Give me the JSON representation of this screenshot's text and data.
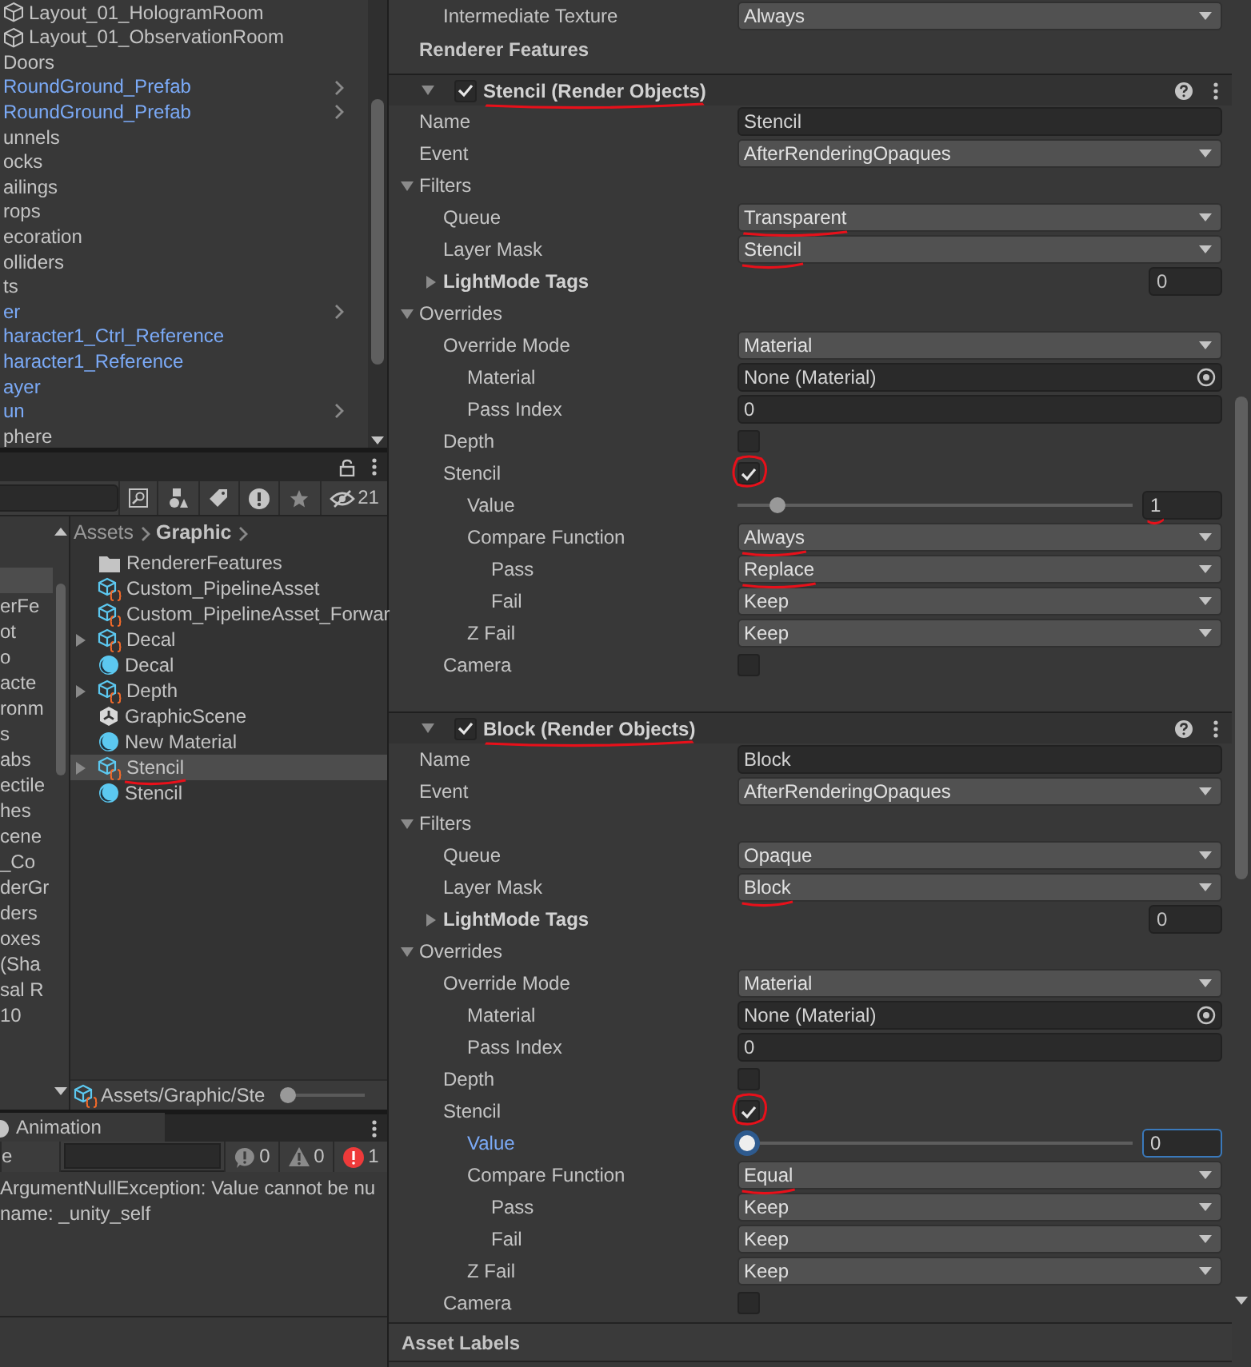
{
  "hierarchy": {
    "items": [
      {
        "label": "Layout_01_HologramRoom",
        "prefab": false,
        "has_children": false,
        "show_icon": true
      },
      {
        "label": "Layout_01_ObservationRoom",
        "prefab": false,
        "has_children": false,
        "show_icon": true
      },
      {
        "label": "Doors",
        "prefab": false,
        "has_children": false
      },
      {
        "label": "RoundGround_Prefab",
        "prefab": true,
        "has_children": true
      },
      {
        "label": "RoundGround_Prefab",
        "prefab": true,
        "has_children": true
      },
      {
        "label": "unnels",
        "prefab": false,
        "has_children": false
      },
      {
        "label": "ocks",
        "prefab": false,
        "has_children": false
      },
      {
        "label": "ailings",
        "prefab": false,
        "has_children": false
      },
      {
        "label": "rops",
        "prefab": false,
        "has_children": false
      },
      {
        "label": "ecoration",
        "prefab": false,
        "has_children": false
      },
      {
        "label": "olliders",
        "prefab": false,
        "has_children": false
      },
      {
        "label": "ts",
        "prefab": false,
        "has_children": false
      },
      {
        "label": "er",
        "prefab": true,
        "has_children": true
      },
      {
        "label": "haracter1_Ctrl_Reference",
        "prefab": true,
        "has_children": false
      },
      {
        "label": "haracter1_Reference",
        "prefab": true,
        "has_children": false
      },
      {
        "label": "ayer",
        "prefab": true,
        "has_children": false
      },
      {
        "label": "un",
        "prefab": true,
        "has_children": true
      },
      {
        "label": "phere",
        "prefab": false,
        "has_children": false
      }
    ]
  },
  "project": {
    "hidden_count": "21",
    "folder_tree": [
      {
        "selected": true
      },
      {
        "label": "erFe",
        "selected": false
      },
      {
        "label": "ot",
        "selected": false
      },
      {
        "label": "o",
        "selected": false
      },
      {
        "label": "acte",
        "selected": false
      },
      {
        "label": "ronm",
        "selected": false
      },
      {
        "label": "s",
        "selected": false
      },
      {
        "label": "abs",
        "selected": false
      },
      {
        "label": "ectile",
        "selected": false
      },
      {
        "label": "hes",
        "selected": false
      },
      {
        "label": "cene",
        "selected": false
      },
      {
        "label": "_Co",
        "selected": false
      },
      {
        "label": "derGr",
        "selected": false
      },
      {
        "label": "ders",
        "selected": false
      },
      {
        "label": "oxes",
        "selected": false
      },
      {
        "label": "(Sha",
        "selected": false
      },
      {
        "label": "sal R",
        "selected": false
      },
      {
        "label": "10",
        "selected": false
      }
    ],
    "breadcrumb": [
      {
        "label": "Assets",
        "bold": false
      },
      {
        "label": "Graphic",
        "bold": true
      }
    ],
    "items": [
      {
        "kind": "folder",
        "label": "RendererFeatures",
        "expandable": false,
        "selected": false
      },
      {
        "kind": "asset",
        "label": "Custom_PipelineAsset",
        "expandable": false,
        "selected": false
      },
      {
        "kind": "asset",
        "label": "Custom_PipelineAsset_Forwar",
        "expandable": false,
        "selected": false
      },
      {
        "kind": "asset",
        "label": "Decal",
        "expandable": true,
        "selected": false
      },
      {
        "kind": "material",
        "label": "Decal",
        "expandable": false,
        "selected": false
      },
      {
        "kind": "asset",
        "label": "Depth",
        "expandable": true,
        "selected": false
      },
      {
        "kind": "scene",
        "label": "GraphicScene",
        "expandable": false,
        "selected": false
      },
      {
        "kind": "material",
        "label": "New Material",
        "expandable": false,
        "selected": false
      },
      {
        "kind": "asset",
        "label": "Stencil",
        "expandable": true,
        "selected": true,
        "annotated": true
      },
      {
        "kind": "material",
        "label": "Stencil",
        "expandable": false,
        "selected": false
      }
    ],
    "path": "Assets/Graphic/Ste",
    "zoom": {
      "level": 0.05
    }
  },
  "console": {
    "tab": "Animation",
    "clear_button": "e",
    "counts": [
      {
        "kind": "info",
        "count": "0"
      },
      {
        "kind": "warning",
        "count": "0"
      },
      {
        "kind": "error",
        "count": "1"
      }
    ],
    "messages": [
      "ArgumentNullException: Value cannot be nu",
      "name: _unity_self"
    ]
  },
  "inspector": {
    "top_row": {
      "label": "Intermediate Texture",
      "value": "Always"
    },
    "section_title": "Renderer Features",
    "features": [
      {
        "title": "Stencil (Render Objects)",
        "enabled": true,
        "expanded": true,
        "annotated": true,
        "rows": [
          {
            "kind": "text",
            "label": "Name",
            "value": "Stencil"
          },
          {
            "kind": "dropdown",
            "label": "Event",
            "value": "AfterRenderingOpaques"
          },
          {
            "kind": "foldout",
            "label": "Filters",
            "expanded": true,
            "children": [
              {
                "kind": "dropdown",
                "label": "Queue",
                "value": "Transparent",
                "annotated": true
              },
              {
                "kind": "dropdown",
                "label": "Layer Mask",
                "value": "Stencil",
                "annotated": true
              },
              {
                "kind": "list",
                "label": "LightMode Tags",
                "expanded": false,
                "value": "0"
              }
            ]
          },
          {
            "kind": "foldout",
            "label": "Overrides",
            "expanded": true,
            "children": [
              {
                "kind": "dropdown",
                "label": "Override Mode",
                "value": "Material",
                "children": [
                  {
                    "kind": "object",
                    "label": "Material",
                    "value": "None (Material)"
                  },
                  {
                    "kind": "text",
                    "label": "Pass Index",
                    "value": "0"
                  }
                ]
              },
              {
                "kind": "checkbox",
                "label": "Depth",
                "checked": false
              },
              {
                "kind": "checkbox",
                "label": "Stencil",
                "checked": true,
                "annotated": true,
                "children": [
                  {
                    "kind": "slider",
                    "label": "Value",
                    "level": 0.08,
                    "value": "1",
                    "focused": false,
                    "annotated": true
                  },
                  {
                    "kind": "dropdown",
                    "label": "Compare Function",
                    "value": "Always",
                    "annotated": true,
                    "children": [
                      {
                        "kind": "dropdown",
                        "label": "Pass",
                        "value": "Replace",
                        "annotated": true
                      },
                      {
                        "kind": "dropdown",
                        "label": "Fail",
                        "value": "Keep"
                      }
                    ]
                  },
                  {
                    "kind": "dropdown",
                    "label": "Z Fail",
                    "value": "Keep"
                  }
                ]
              },
              {
                "kind": "checkbox",
                "label": "Camera",
                "checked": false
              }
            ]
          }
        ]
      },
      {
        "title": "Block (Render Objects)",
        "enabled": true,
        "expanded": true,
        "annotated": true,
        "rows": [
          {
            "kind": "text",
            "label": "Name",
            "value": "Block"
          },
          {
            "kind": "dropdown",
            "label": "Event",
            "value": "AfterRenderingOpaques"
          },
          {
            "kind": "foldout",
            "label": "Filters",
            "expanded": true,
            "children": [
              {
                "kind": "dropdown",
                "label": "Queue",
                "value": "Opaque"
              },
              {
                "kind": "dropdown",
                "label": "Layer Mask",
                "value": "Block",
                "annotated": true
              },
              {
                "kind": "list",
                "label": "LightMode Tags",
                "expanded": false,
                "value": "0"
              }
            ]
          },
          {
            "kind": "foldout",
            "label": "Overrides",
            "expanded": true,
            "children": [
              {
                "kind": "dropdown",
                "label": "Override Mode",
                "value": "Material",
                "children": [
                  {
                    "kind": "object",
                    "label": "Material",
                    "value": "None (Material)"
                  },
                  {
                    "kind": "text",
                    "label": "Pass Index",
                    "value": "0"
                  }
                ]
              },
              {
                "kind": "checkbox",
                "label": "Depth",
                "checked": false
              },
              {
                "kind": "checkbox",
                "label": "Stencil",
                "checked": true,
                "annotated": true,
                "children": [
                  {
                    "kind": "slider",
                    "label": "Value",
                    "level": 0,
                    "value": "0",
                    "focused": true
                  },
                  {
                    "kind": "dropdown",
                    "label": "Compare Function",
                    "value": "Equal",
                    "annotated": true,
                    "children": [
                      {
                        "kind": "dropdown",
                        "label": "Pass",
                        "value": "Keep"
                      },
                      {
                        "kind": "dropdown",
                        "label": "Fail",
                        "value": "Keep"
                      }
                    ]
                  },
                  {
                    "kind": "dropdown",
                    "label": "Z Fail",
                    "value": "Keep"
                  }
                ]
              },
              {
                "kind": "checkbox",
                "label": "Camera",
                "checked": false
              }
            ]
          }
        ]
      }
    ],
    "asset_labels": "Asset Labels"
  }
}
